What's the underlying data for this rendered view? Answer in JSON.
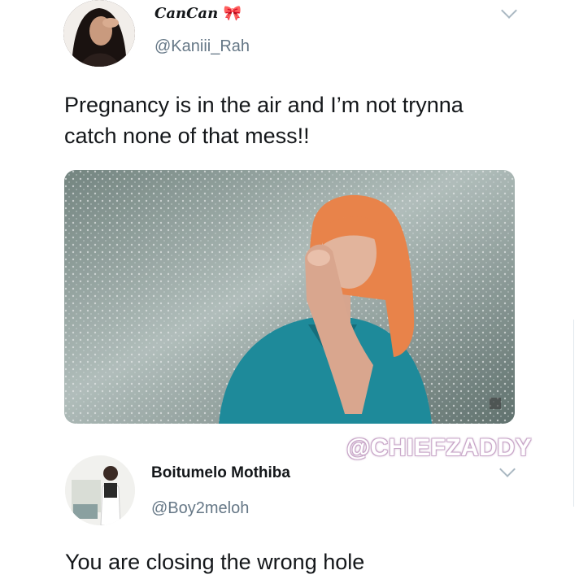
{
  "tweet1": {
    "display_name": "CanCan",
    "handle": "@Kaniii_Rah",
    "text_line1": "Pregnancy is in the air and I’m not trynna",
    "text_line2": "catch none of that mess!!",
    "ribbon_icon": "ribbon-emoji"
  },
  "watermark": "@CHIEFZADDY",
  "tweet2": {
    "display_name": "Boitumelo Mothiba",
    "handle": "@Boy2meloh",
    "text": "You are closing the wrong hole"
  },
  "colors": {
    "handle": "#657786",
    "text": "#14171a",
    "hair": "#e8834a",
    "shirt": "#1e8a9a"
  }
}
